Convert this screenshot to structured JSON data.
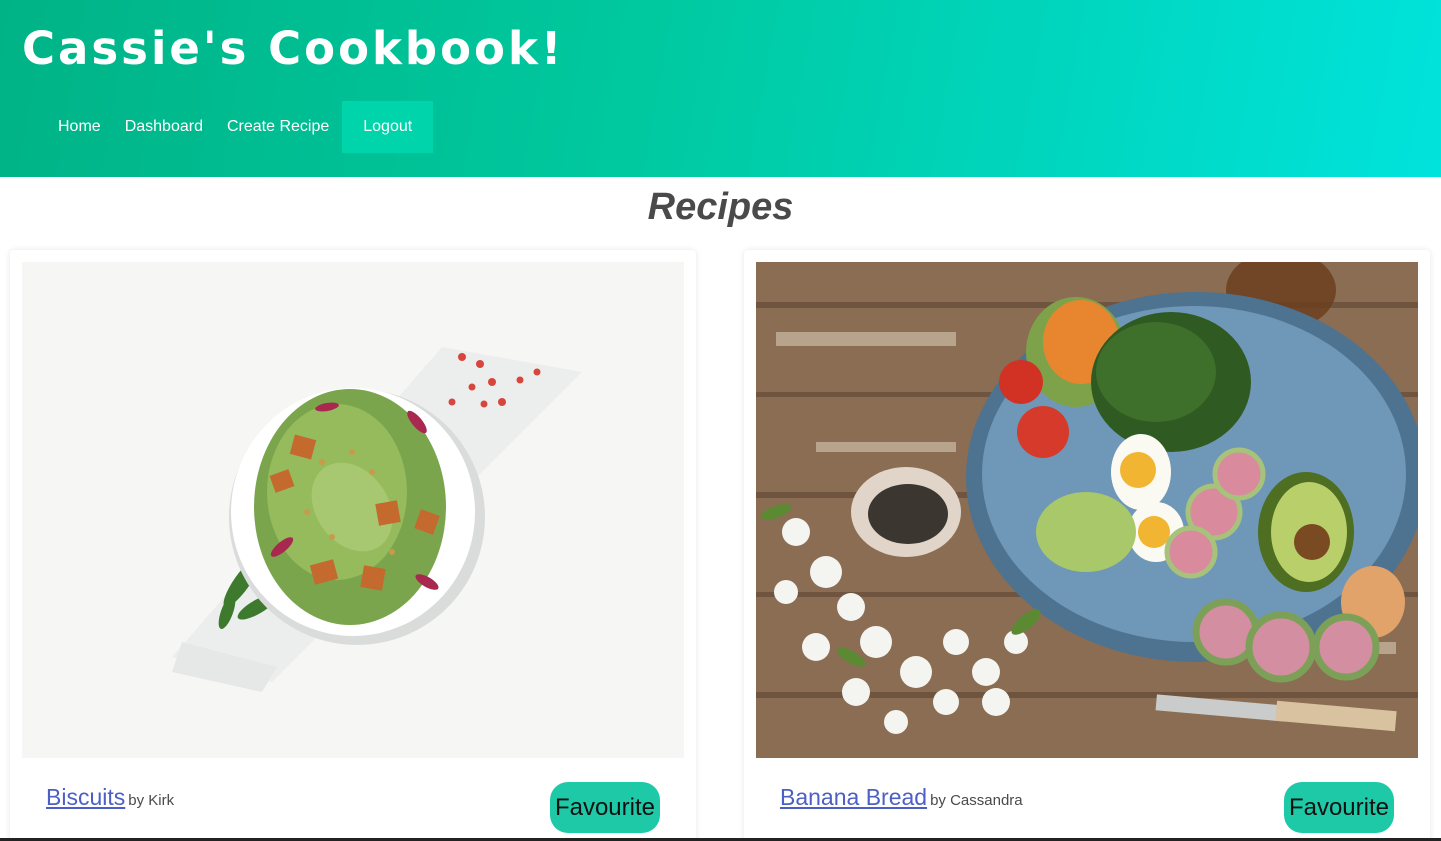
{
  "header": {
    "title": "Cassie's Cookbook!",
    "nav": [
      {
        "label": "Home"
      },
      {
        "label": "Dashboard"
      },
      {
        "label": "Create Recipe"
      },
      {
        "label": "Logout",
        "active": true
      }
    ]
  },
  "main": {
    "heading": "Recipes",
    "recipes": [
      {
        "name": "Biscuits",
        "author": "by Kirk",
        "favourite_label": "Favourite",
        "image": "salad-bowl-on-marble-board-photo"
      },
      {
        "name": "Banana Bread",
        "author": "by Cassandra",
        "favourite_label": "Favourite",
        "image": "salad-plate-on-wooden-table-photo"
      }
    ]
  },
  "colors": {
    "header_gradient_start": "#00b386",
    "header_gradient_end": "#00e3dc",
    "active_nav": "#00d4ab",
    "recipe_link": "#4b5fc5",
    "favourite_button": "#1dc9a6"
  }
}
